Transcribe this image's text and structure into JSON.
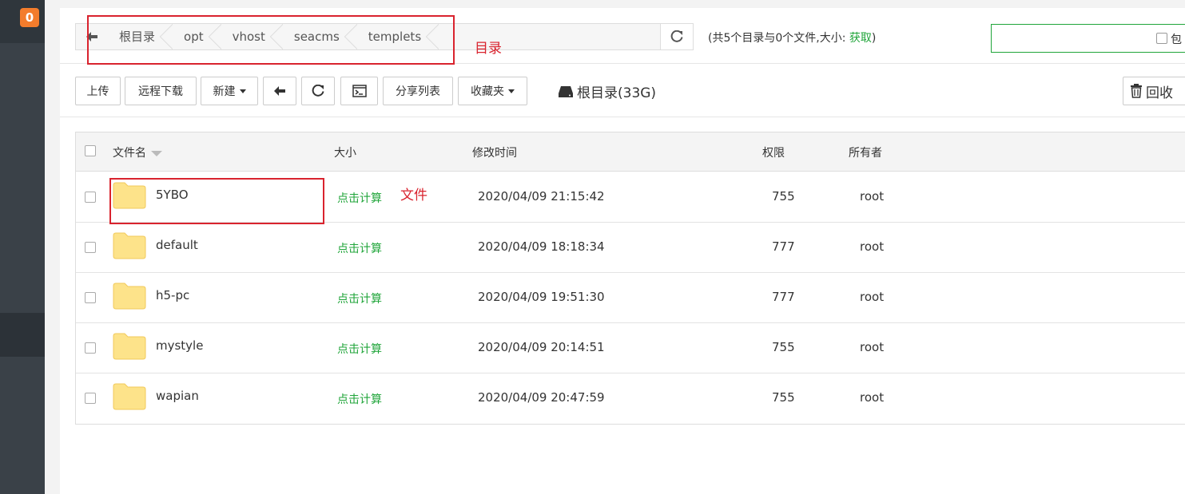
{
  "sidebar": {
    "badge": "0"
  },
  "path": {
    "crumbs": [
      "根目录",
      "opt",
      "vhost",
      "seacms",
      "templets"
    ]
  },
  "summary": {
    "text": "(共5个目录与0个文件,大小: ",
    "get_label": "获取",
    "close": ")"
  },
  "search": {
    "checkbox_label": "包"
  },
  "toolbar": {
    "upload": "上传",
    "remote_download": "远程下载",
    "new": "新建",
    "share_list": "分享列表",
    "favorites": "收藏夹",
    "disk": "根目录(33G)",
    "recycle": "回收"
  },
  "table": {
    "headers": {
      "name": "文件名",
      "size": "大小",
      "mtime": "修改时间",
      "perm": "权限",
      "owner": "所有者"
    },
    "rows": [
      {
        "name": "5YBO",
        "size": "点击计算",
        "mtime": "2020/04/09 21:15:42",
        "perm": "755",
        "owner": "root"
      },
      {
        "name": "default",
        "size": "点击计算",
        "mtime": "2020/04/09 18:18:34",
        "perm": "777",
        "owner": "root"
      },
      {
        "name": "h5-pc",
        "size": "点击计算",
        "mtime": "2020/04/09 19:51:30",
        "perm": "777",
        "owner": "root"
      },
      {
        "name": "mystyle",
        "size": "点击计算",
        "mtime": "2020/04/09 20:14:51",
        "perm": "755",
        "owner": "root"
      },
      {
        "name": "wapian",
        "size": "点击计算",
        "mtime": "2020/04/09 20:47:59",
        "perm": "755",
        "owner": "root"
      }
    ]
  },
  "annotations": {
    "directory": "目录",
    "file": "文件"
  },
  "colors": {
    "accent": "#20a53a",
    "annotation": "#d9232e",
    "badge": "#f37c2c",
    "folder": "#fde38a"
  }
}
